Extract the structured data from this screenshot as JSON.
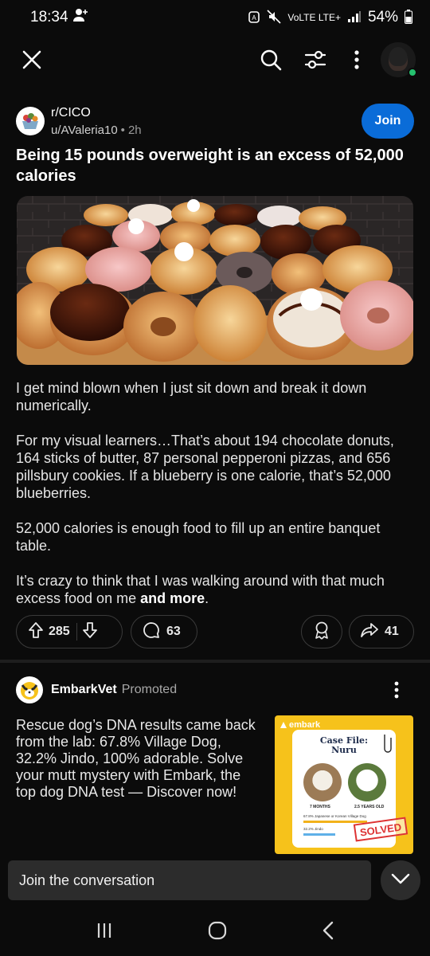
{
  "status_bar": {
    "time": "18:34",
    "network": "VoLTE LTE+",
    "battery": "54%"
  },
  "app_bar": {
    "icons": [
      "close-icon",
      "search-icon",
      "filter-icon",
      "more-vert-icon",
      "avatar"
    ]
  },
  "post": {
    "subreddit": "r/CICO",
    "author": "u/AValeria10",
    "age": "2h",
    "join_label": "Join",
    "title": "Being 15 pounds overweight is an excess of 52,000 calories",
    "paragraphs": [
      "I get mind blown when I just sit down and break it down numerically.",
      "For my visual learners…That’s about 194 chocolate donuts, 164 sticks of butter, 87 personal pepperoni pizzas, and 656 pillsbury cookies. If a blueberry is one calorie, that’s 52,000 blueberries.",
      "52,000 calories is enough food to fill up an entire banquet table."
    ],
    "last_paragraph": "It’s crazy to think that I was walking around with that much excess food on me",
    "more_label": "and more",
    "votes": "285",
    "comments": "63",
    "shares": "41"
  },
  "ad": {
    "name": "EmbarkVet",
    "promoted_label": "Promoted",
    "text": "Rescue dog’s DNA results came back from the lab: 67.8% Village Dog, 32.2% Jindo, 100% adorable. Solve your mutt mystery with Embark, the top dog DNA test — Discover now!",
    "image": {
      "brand": "embark",
      "case_title_1": "Case File:",
      "case_title_2": "Nuru",
      "age_1": "7 MONTHS",
      "age_2": "2.5 YEARS OLD",
      "breed_1": "67.8% Japanese or Korean Village Dog",
      "breed_2": "32.2% Jindo",
      "stamp": "SOLVED"
    }
  },
  "composer": {
    "placeholder": "Join the conversation"
  },
  "colors": {
    "background": "#0b0b0b",
    "join_button": "#0a6cd8",
    "online_dot": "#25c16f",
    "ad_background": "#f6c21b"
  }
}
